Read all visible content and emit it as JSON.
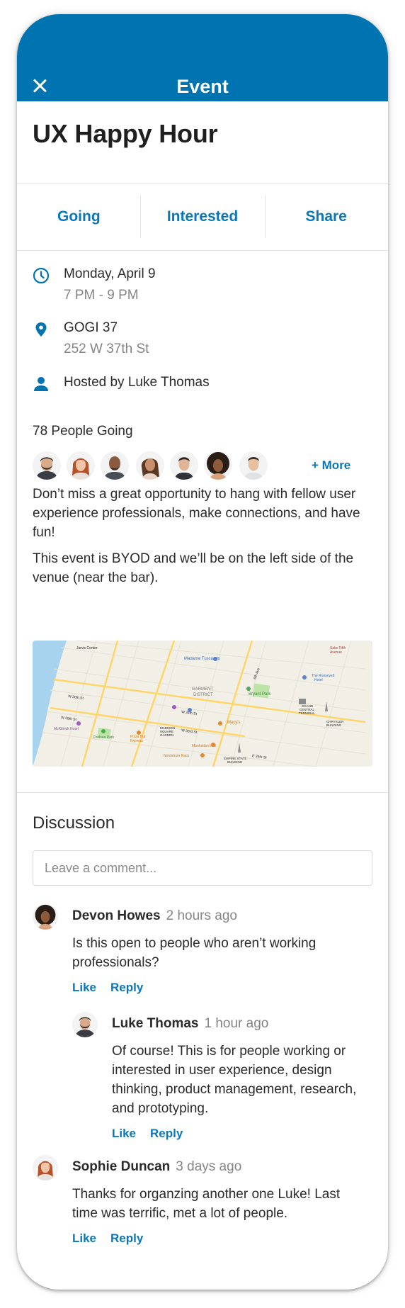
{
  "header": {
    "title": "Event",
    "close_icon": "close-icon"
  },
  "event": {
    "title": "UX Happy Hour",
    "actions": [
      "Going",
      "Interested",
      "Share"
    ],
    "date": "Monday, April 9",
    "time": "7 PM - 9 PM",
    "venue": "GOGI 37",
    "address": "252 W 37th St",
    "host": "Hosted by Luke Thomas",
    "going_count": "78 People Going",
    "more_label": "+ More",
    "description": [
      "Don’t miss a great opportunity to hang with fellow user experience professionals, make connections, and have fun!",
      "This event is BYOD and we’ll be on the left side of the venue (near the bar)."
    ]
  },
  "map": {
    "labels": [
      "Jarvis Center",
      "Madame Tussauds",
      "Saks Fifth Avenue",
      "The Roosevelt Hotel",
      "GARMENT DISTRICT",
      "Bryant Park",
      "Macy's",
      "GRAND CENTRAL TERMINAL",
      "CHRYSLER BUILDING",
      "McKittrick Hotel",
      "Chelsea Park",
      "Pizza Hut Express",
      "MADISON SQUARE GARDEN",
      "Manhattan Mall",
      "EMPIRE STATE BUILDING",
      "Nordstrom Rack",
      "W 30th St",
      "W 34th St",
      "W 28th St",
      "W 33rd St",
      "E 34th St",
      "6th Ave"
    ],
    "colors": {
      "land": "#f2efe7",
      "water": "#a8d3ee",
      "road": "#ffd566",
      "park": "#bde3a8"
    }
  },
  "discussion": {
    "title": "Discussion",
    "placeholder": "Leave a comment...",
    "like_label": "Like",
    "reply_label": "Reply",
    "comments": [
      {
        "name": "Devon Howes",
        "time": "2 hours ago",
        "text": "Is this open to people who aren’t working professionals?"
      },
      {
        "name": "Luke Thomas",
        "time": "1 hour ago",
        "text": "Of course! This is for people working or interested in user experience, design thinking, product management, research, and prototyping.",
        "reply": true
      },
      {
        "name": "Sophie Duncan",
        "time": "3 days ago",
        "text": "Thanks for organzing another one Luke! Last time was terrific, met a lot of people."
      }
    ]
  },
  "colors": {
    "brand": "#0073b1",
    "link": "#0a78b8",
    "muted": "#858585"
  }
}
